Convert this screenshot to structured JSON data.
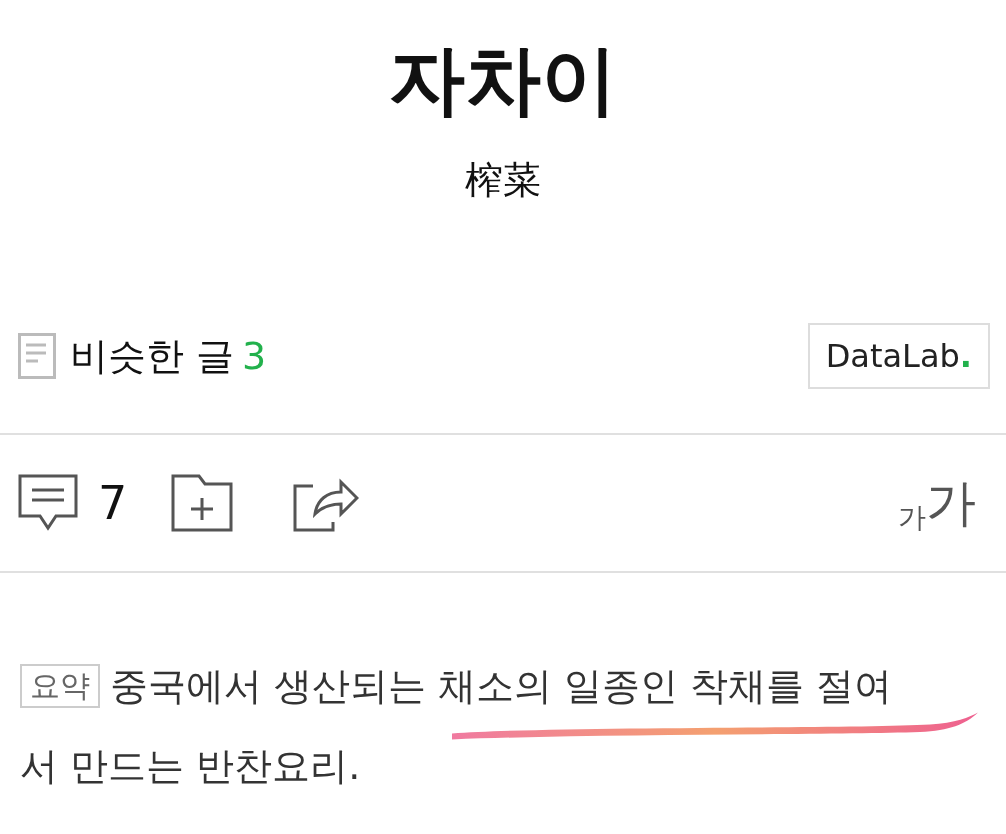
{
  "title": "자차이",
  "subtitle": "榨菜",
  "similar": {
    "label": "비슷한 글",
    "count": "3"
  },
  "datalab_button": {
    "text": "DataLab",
    "dot": "."
  },
  "actions": {
    "comment_count": "7",
    "font_size": {
      "small": "가",
      "large": "가"
    }
  },
  "summary": {
    "badge": "요약",
    "lines": [
      "중국에서 생산되는 채소의 일종인 착채를 절여",
      "서 만드는 반찬요리."
    ]
  }
}
